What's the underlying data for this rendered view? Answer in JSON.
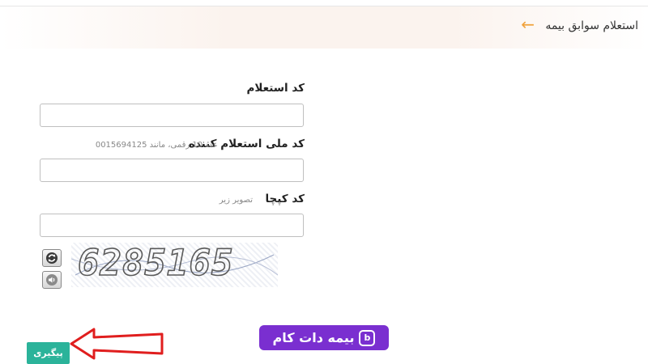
{
  "header": {
    "title": "استعلام سوابق بیمه",
    "back_icon": "arrow-left-icon",
    "accent_color": "#f0a23c"
  },
  "form": {
    "inquiry_code": {
      "label": "کد استعلام",
      "value": "",
      "placeholder": ""
    },
    "national_code": {
      "label": "کد ملی استعلام کننده",
      "hint": "عدد 10 رقمی، مانند 0015694125",
      "value": "",
      "placeholder": ""
    },
    "captcha": {
      "label": "کد کپچا",
      "hint": "تصویر زیر",
      "value": "",
      "placeholder": "",
      "image_text": "6285165"
    },
    "refresh_icon": "refresh-icon",
    "audio_icon": "speaker-icon"
  },
  "actions": {
    "submit_label": "پیگیری",
    "submit_color": "#2bb39a"
  },
  "watermark": {
    "brand": "بیمه دات کام",
    "color": "#7a2fd0"
  }
}
